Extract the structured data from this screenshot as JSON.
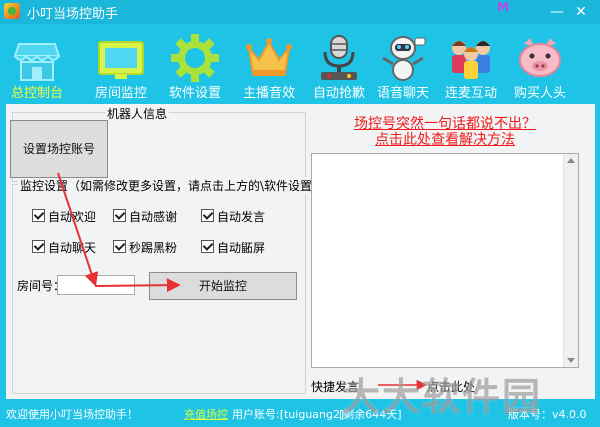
{
  "window": {
    "title": "小叮当场控助手",
    "logo_mark": "M",
    "min_glyph": "—",
    "close_glyph": "✕"
  },
  "nav": [
    {
      "label": "总控制台",
      "icon": "storefront-icon",
      "active": true
    },
    {
      "label": "房间监控",
      "icon": "monitor-screen-icon",
      "active": false
    },
    {
      "label": "软件设置",
      "icon": "gear-icon",
      "active": false
    },
    {
      "label": "主播音效",
      "icon": "crown-icon",
      "active": false
    },
    {
      "label": "自动抢歉",
      "icon": "microphone-robot-icon",
      "active": false
    },
    {
      "label": "语音聊天",
      "icon": "chat-robot-icon",
      "active": false
    },
    {
      "label": "连麦互动",
      "icon": "group-people-icon",
      "active": false
    },
    {
      "label": "购买人头",
      "icon": "pig-icon",
      "active": false
    }
  ],
  "robot_info": {
    "legend": "机器人信息",
    "set_account_label": "设置场控账号"
  },
  "monitor_settings": {
    "legend": "监控设置（如需修改更多设置，请点击上方的\\软件设置）",
    "checkboxes": [
      {
        "label": "自动欢迎",
        "checked": true
      },
      {
        "label": "自动感谢",
        "checked": true
      },
      {
        "label": "自动发言",
        "checked": true
      },
      {
        "label": "自动聊天",
        "checked": true
      },
      {
        "label": "秒踢黑粉",
        "checked": true
      },
      {
        "label": "自动鼫屏",
        "checked": true
      }
    ],
    "room_label": "房间号：",
    "room_value": "",
    "start_label": "开始监控"
  },
  "help": {
    "line1": "场控号突然一句话都说不出？",
    "line2": "点击此处查看解决方法"
  },
  "quick_speech": {
    "label": "快捷发言：",
    "link": "点击此处"
  },
  "status_bar": {
    "welcome": "欢迎使用小叮当场控助手！",
    "recharge": "充值场控",
    "user": "用户账号:[tuiguang2]",
    "remain": "[剩余644天]",
    "version": "版本号：v4.0.0"
  },
  "watermark": "大大软件园",
  "colors": {
    "background": "#1ec3e6",
    "panel": "#f1f3f4",
    "active_nav": "#e8ff41",
    "help_text": "#ee1c1c",
    "arrow": "#e63232"
  }
}
